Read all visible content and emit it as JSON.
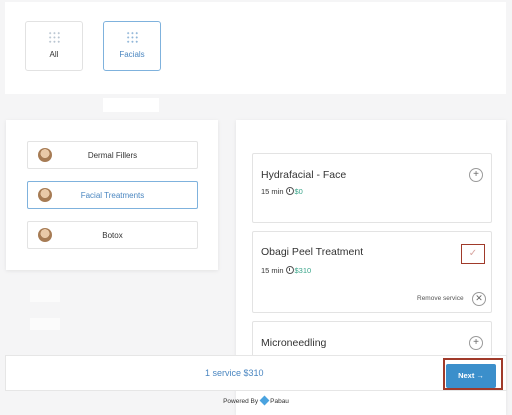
{
  "categories": {
    "all_label": "All",
    "facials_label": "Facials"
  },
  "service_categories": [
    {
      "label": "Dermal Fillers"
    },
    {
      "label": "Facial Treatments"
    },
    {
      "label": "Botox"
    }
  ],
  "services": [
    {
      "title": "Hydrafacial - Face",
      "duration": "15 min",
      "price": "$0"
    },
    {
      "title": "Obagi Peel Treatment",
      "duration": "15 min",
      "price": "$310",
      "selected": true,
      "remove_label": "Remove service"
    },
    {
      "title": "Microneedling"
    }
  ],
  "bottom_bar": {
    "summary": "1 service $310",
    "next_label": "Next →"
  },
  "footer": {
    "powered_by": "Powered By",
    "brand": "Pabau"
  },
  "colors": {
    "accent": "#4a86c0",
    "button": "#3b8fcb",
    "price": "#3aa58a",
    "highlight": "#a03a2a"
  }
}
